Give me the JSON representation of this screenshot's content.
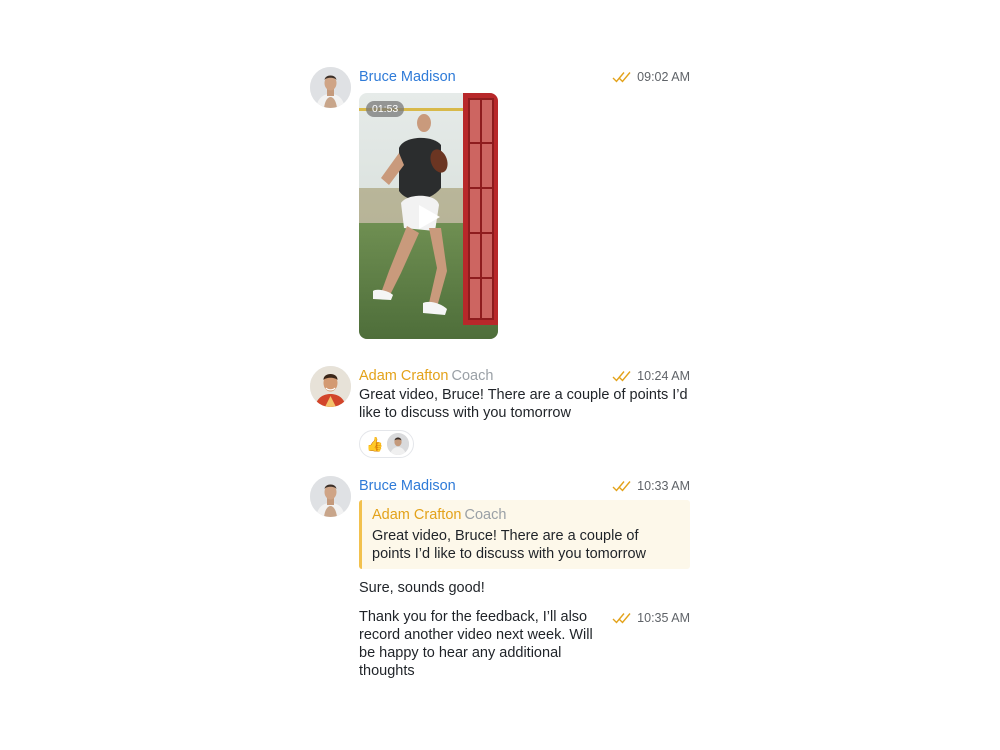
{
  "messages": [
    {
      "sender": "Bruce Madison",
      "time": "09:02 AM",
      "video": {
        "duration": "01:53"
      }
    },
    {
      "sender": "Adam Crafton",
      "role": "Coach",
      "time": "10:24 AM",
      "text": "Great video, Bruce! There are a couple of points I’d like to discuss with you tomorrow",
      "reaction": {
        "emoji": "👍"
      }
    },
    {
      "sender": "Bruce Madison",
      "time": "10:33 AM",
      "quote": {
        "sender": "Adam Crafton",
        "role": "Coach",
        "text": "Great video, Bruce! There are a couple of points I’d like to discuss with you tomorrow"
      },
      "text": "Sure, sounds good!"
    },
    {
      "time": "10:35 AM",
      "text": "Thank you for the feedback, I’ll also record another video next week. Will be happy to hear any additional thoughts"
    }
  ],
  "colors": {
    "bruce_name": "#2f7bd8",
    "coach_name": "#e3a21a",
    "read_ticks": "#e3a21a",
    "quote_bg": "#fdf8ea",
    "quote_border": "#f2c14e"
  },
  "icons": {
    "read": "double-check-icon",
    "play": "play-icon"
  }
}
